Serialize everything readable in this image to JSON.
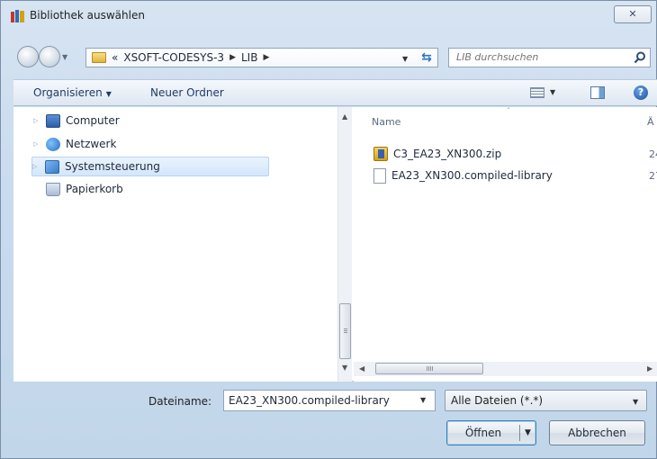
{
  "window": {
    "title": "Bibliothek auswählen",
    "close_label": "✕"
  },
  "address": {
    "overflow_label": "«",
    "breadcrumb": [
      "XSOFT-CODESYS-3",
      "LIB"
    ],
    "search_placeholder": "LIB durchsuchen"
  },
  "toolbar": {
    "organize_label": "Organisieren",
    "new_folder_label": "Neuer Ordner",
    "help_label": "?"
  },
  "nav_tree": {
    "items": [
      {
        "label": "Computer",
        "icon": "computer-icon"
      },
      {
        "label": "Netzwerk",
        "icon": "network-icon"
      },
      {
        "label": "Systemsteuerung",
        "icon": "control-panel-icon",
        "selected": true
      },
      {
        "label": "Papierkorb",
        "icon": "recycle-bin-icon"
      }
    ]
  },
  "file_list": {
    "columns": [
      "Name",
      "Ä"
    ],
    "files": [
      {
        "name": "C3_EA23_XN300.zip",
        "icon": "zip-icon",
        "date_fragment": "24"
      },
      {
        "name": "EA23_XN300.compiled-library",
        "icon": "document-icon",
        "date_fragment": "27"
      }
    ]
  },
  "footer": {
    "filename_label": "Dateiname:",
    "filename_value": "EA23_XN300.compiled-library",
    "filetype_value": "Alle Dateien (*.*)",
    "open_label": "Öffnen",
    "cancel_label": "Abbrechen"
  }
}
